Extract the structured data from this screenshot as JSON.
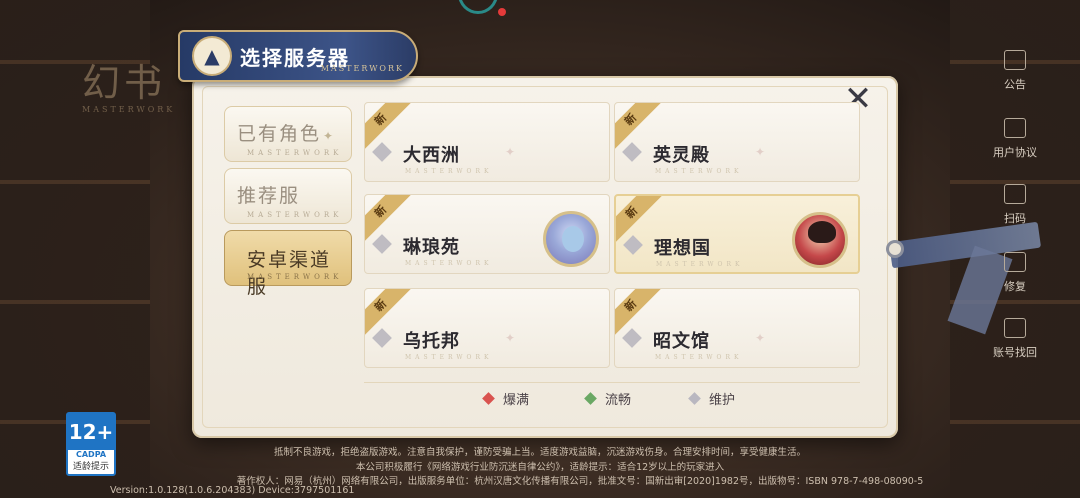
{
  "header": {
    "title": "选择服务器",
    "subtitle": "MASTERWORK",
    "logo_text": "幻书",
    "logo_sub": "MASTERWORK"
  },
  "tabs": [
    {
      "label": "已有角色",
      "sub": "MASTERWORK",
      "active": false
    },
    {
      "label": "推荐服",
      "sub": "MASTERWORK",
      "active": false
    },
    {
      "label": "安卓渠道服",
      "sub": "MASTERWORK",
      "active": true
    }
  ],
  "servers": [
    {
      "name": "大西洲",
      "badge": "新",
      "sub": "MASTERWORK"
    },
    {
      "name": "英灵殿",
      "badge": "新",
      "sub": "MASTERWORK"
    },
    {
      "name": "琳琅苑",
      "badge": "新",
      "sub": "MASTERWORK"
    },
    {
      "name": "理想国",
      "badge": "新",
      "sub": "MASTERWORK"
    },
    {
      "name": "乌托邦",
      "badge": "新",
      "sub": "MASTERWORK"
    },
    {
      "name": "昭文馆",
      "badge": "新",
      "sub": "MASTERWORK"
    }
  ],
  "legend": [
    {
      "label": "爆满",
      "color": "#d9534f"
    },
    {
      "label": "流畅",
      "color": "#6aa864"
    },
    {
      "label": "维护",
      "color": "#b9b7c0"
    }
  ],
  "sidebar": [
    {
      "label": "公告",
      "icon": "announcement-icon"
    },
    {
      "label": "用户协议",
      "icon": "document-icon"
    },
    {
      "label": "扫码",
      "icon": "scan-icon"
    },
    {
      "label": "修复",
      "icon": "repair-icon"
    },
    {
      "label": "账号找回",
      "icon": "account-recover-icon"
    }
  ],
  "age_rating": {
    "number": "12+",
    "org": "CADPA",
    "label": "适龄提示"
  },
  "footer": {
    "line1": "抵制不良游戏，拒绝盗版游戏。注意自我保护，谨防受骗上当。适度游戏益脑，沉迷游戏伤身。合理安排时间，享受健康生活。",
    "line2": "本公司积极履行《网络游戏行业防沉迷自律公约》，适龄提示：适合12岁以上的玩家进入",
    "line3": "著作权人：网易（杭州）网络有限公司，出版服务单位：杭州汉唐文化传播有限公司，批准文号：国新出审[2020]1982号，出版物号：ISBN 978-7-498-08090-5",
    "version": "Version:1.0.128(1.0.6.204383) Device:3797501161"
  }
}
